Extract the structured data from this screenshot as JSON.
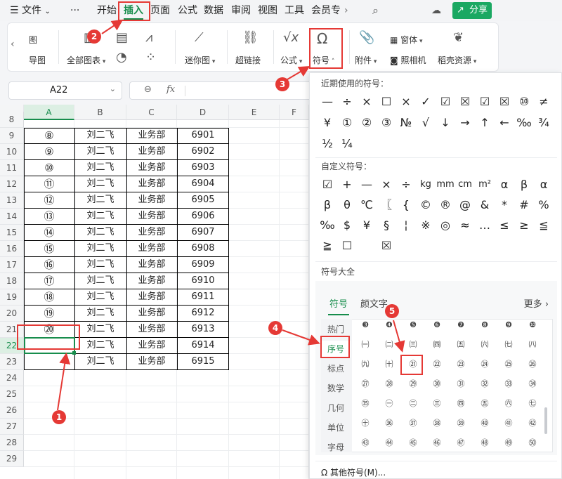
{
  "menubar": {
    "items": [
      "文件",
      "···",
      "开始",
      "插入",
      "页面",
      "公式",
      "数据",
      "审阅",
      "视图",
      "工具",
      "会员专"
    ],
    "share": "分享"
  },
  "ribbon": {
    "left_top": "图",
    "left_bottom": "导图",
    "all_charts": "全部图表",
    "sparkline": "迷你图",
    "hyperlink": "超链接",
    "formula": "公式",
    "symbol": "符号",
    "attachment": "附件",
    "window": "窗体",
    "camera": "照相机",
    "resources": "稻壳资源"
  },
  "formula_bar": {
    "cell_ref": "A22",
    "fx": "fx"
  },
  "sheet": {
    "columns": [
      "A",
      "B",
      "C",
      "D",
      "E",
      "F"
    ],
    "row_numbers": [
      "8",
      "9",
      "10",
      "11",
      "12",
      "13",
      "14",
      "15",
      "16",
      "17",
      "18",
      "19",
      "20",
      "21",
      "22",
      "23",
      "24",
      "25",
      "26",
      "27",
      "28",
      "29"
    ],
    "rows": [
      {
        "a": "⑧",
        "b": "刘二飞",
        "c": "业务部",
        "d": "6901"
      },
      {
        "a": "⑨",
        "b": "刘二飞",
        "c": "业务部",
        "d": "6902"
      },
      {
        "a": "⑩",
        "b": "刘二飞",
        "c": "业务部",
        "d": "6903"
      },
      {
        "a": "⑪",
        "b": "刘二飞",
        "c": "业务部",
        "d": "6904"
      },
      {
        "a": "⑫",
        "b": "刘二飞",
        "c": "业务部",
        "d": "6905"
      },
      {
        "a": "⑬",
        "b": "刘二飞",
        "c": "业务部",
        "d": "6906"
      },
      {
        "a": "⑭",
        "b": "刘二飞",
        "c": "业务部",
        "d": "6907"
      },
      {
        "a": "⑮",
        "b": "刘二飞",
        "c": "业务部",
        "d": "6908"
      },
      {
        "a": "⑯",
        "b": "刘二飞",
        "c": "业务部",
        "d": "6909"
      },
      {
        "a": "⑰",
        "b": "刘二飞",
        "c": "业务部",
        "d": "6910"
      },
      {
        "a": "⑱",
        "b": "刘二飞",
        "c": "业务部",
        "d": "6911"
      },
      {
        "a": "⑲",
        "b": "刘二飞",
        "c": "业务部",
        "d": "6912"
      },
      {
        "a": "⑳",
        "b": "刘二飞",
        "c": "业务部",
        "d": "6913"
      },
      {
        "a": "",
        "b": "刘二飞",
        "c": "业务部",
        "d": "6914"
      },
      {
        "a": "",
        "b": "刘二飞",
        "c": "业务部",
        "d": "6915"
      }
    ]
  },
  "panel": {
    "recent_title": "近期使用的符号：",
    "recent": [
      "—",
      "÷",
      "×",
      "☐",
      "×",
      "✓",
      "☑",
      "☒",
      "☑",
      "☒",
      "⑩",
      "≠",
      "¥",
      "①",
      "②",
      "③",
      "№",
      "√",
      "↓",
      "→",
      "↑",
      "←",
      "‰",
      "¾",
      "½",
      "¼"
    ],
    "custom_title": "自定义符号：",
    "custom": [
      "☑",
      "+",
      "—",
      "×",
      "÷",
      "kg",
      "mm",
      "cm",
      "m²",
      "α",
      "β",
      "α",
      "β",
      "θ",
      "℃",
      "〖",
      "{",
      "©",
      "®",
      "@",
      "&",
      "*",
      "#",
      "%",
      "‰",
      "$",
      "¥",
      "§",
      "¦",
      "※",
      "◎",
      "≈",
      "…",
      "≤",
      "≥",
      "≦",
      "≧",
      "☐",
      "",
      "☒"
    ],
    "all_title": "符号大全",
    "tabs": [
      "符号",
      "颜文字"
    ],
    "more": "更多",
    "side_tabs": [
      "热门",
      "序号",
      "标点",
      "数学",
      "几何",
      "单位",
      "字母"
    ],
    "grid": [
      "❸",
      "❹",
      "❺",
      "❻",
      "❼",
      "❽",
      "❾",
      "❿",
      "㈠",
      "㈡",
      "㈢",
      "㈣",
      "㈤",
      "㈥",
      "㈦",
      "㈧",
      "㈨",
      "㈩",
      "㉑",
      "㉒",
      "㉓",
      "㉔",
      "㉕",
      "㉖",
      "㉗",
      "㉘",
      "㉙",
      "㉚",
      "㉛",
      "㉜",
      "㉝",
      "㉞",
      "㉟",
      "㊀",
      "㊁",
      "㊂",
      "㊃",
      "㊄",
      "㊅",
      "㊆",
      "㊉",
      "㊱",
      "㊲",
      "㊳",
      "㊴",
      "㊵",
      "㊶",
      "㊷",
      "㊸",
      "㊹",
      "㊺",
      "㊻",
      "㊼",
      "㊽",
      "㊾",
      "㊿"
    ],
    "other": "其他符号(M)..."
  },
  "annotations": [
    "1",
    "2",
    "3",
    "4",
    "5"
  ],
  "colors": {
    "accent": "#178d4c",
    "annotation": "#e53935",
    "share": "#1aa862"
  }
}
